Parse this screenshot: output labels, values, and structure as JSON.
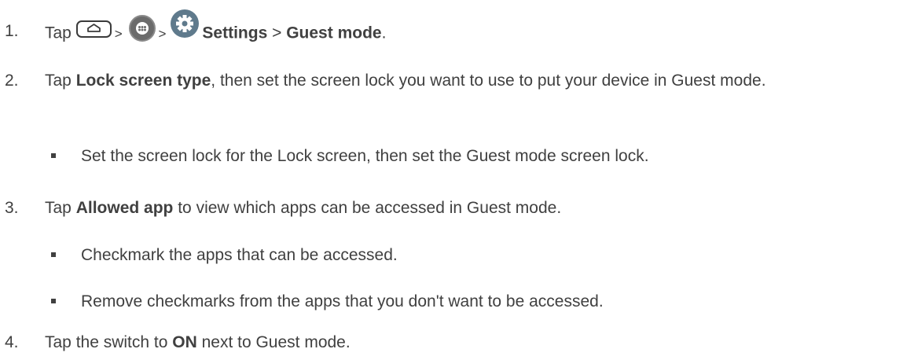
{
  "steps": [
    {
      "number": "1.",
      "prefix": "Tap",
      "sep1": ">",
      "sep2": ">",
      "settings": "Settings",
      "sep3": ">",
      "guest_mode": "Guest mode",
      "end": "."
    },
    {
      "number": "2.",
      "prefix": "Tap ",
      "bold": "Lock screen type",
      "rest": ", then set the screen lock you want to use to put your device in Guest mode.",
      "bullets": [
        "Set the screen lock for the Lock screen, then set the Guest mode screen lock."
      ]
    },
    {
      "number": "3.",
      "prefix": "Tap ",
      "bold": "Allowed app",
      "rest": " to view which apps can be accessed in Guest mode.",
      "bullets": [
        "Checkmark the apps that can be accessed.",
        "Remove checkmarks from the apps that you don't want to be accessed."
      ]
    },
    {
      "number": "4.",
      "prefix": "Tap the switch to ",
      "bold": "ON",
      "rest": " next to Guest mode."
    }
  ],
  "icons": {
    "home": "home-icon",
    "apps": "apps-icon",
    "settings": "settings-gear-icon"
  },
  "colors": {
    "text": "#404040",
    "icon_dark": "#3a3a3a",
    "apps_icon": "#6b6b6b",
    "gear_icon": "#5f7a8c"
  }
}
